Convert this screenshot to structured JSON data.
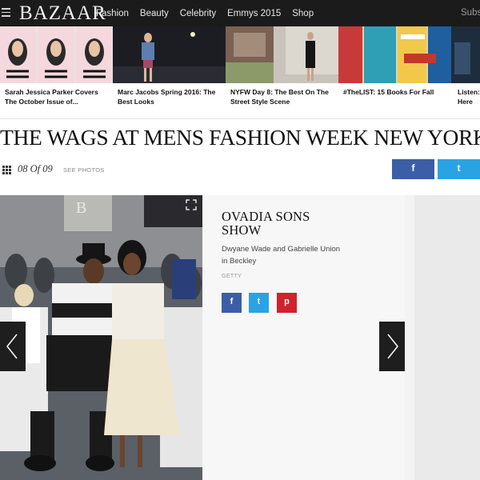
{
  "nav": {
    "logo": "BAZAAR",
    "links": [
      "Fashion",
      "Beauty",
      "Celebrity",
      "Emmys 2015",
      "Shop"
    ],
    "subscribe": "Subs"
  },
  "strip": [
    {
      "caption": "Sarah Jessica Parker Covers The October Issue of..."
    },
    {
      "caption": "Marc Jacobs Spring 2016: The Best Looks"
    },
    {
      "caption": "NYFW Day 8: The Best On The Street Style Scene"
    },
    {
      "caption": "#TheLIST: 15 Books For Fall"
    },
    {
      "caption": "Listen: Here"
    }
  ],
  "headline": "THE WAGS AT MENS FASHION WEEK NEW YORK",
  "counter": "08 Of 09",
  "see_photos": "SEE PHOTOS",
  "share": {
    "facebook": "f",
    "twitter": "t"
  },
  "slide": {
    "title": "OVADIA SONS SHOW",
    "description": "Dwyane Wade and Gabrielle Union in Beckley",
    "credit": "GETTY",
    "share_facebook": "f",
    "share_twitter": "t",
    "share_pinterest": "p"
  },
  "colors": {
    "nav_bg": "#1b1b1b",
    "facebook": "#3b5ea6",
    "twitter": "#2aa3e5",
    "pinterest": "#d0232c"
  }
}
